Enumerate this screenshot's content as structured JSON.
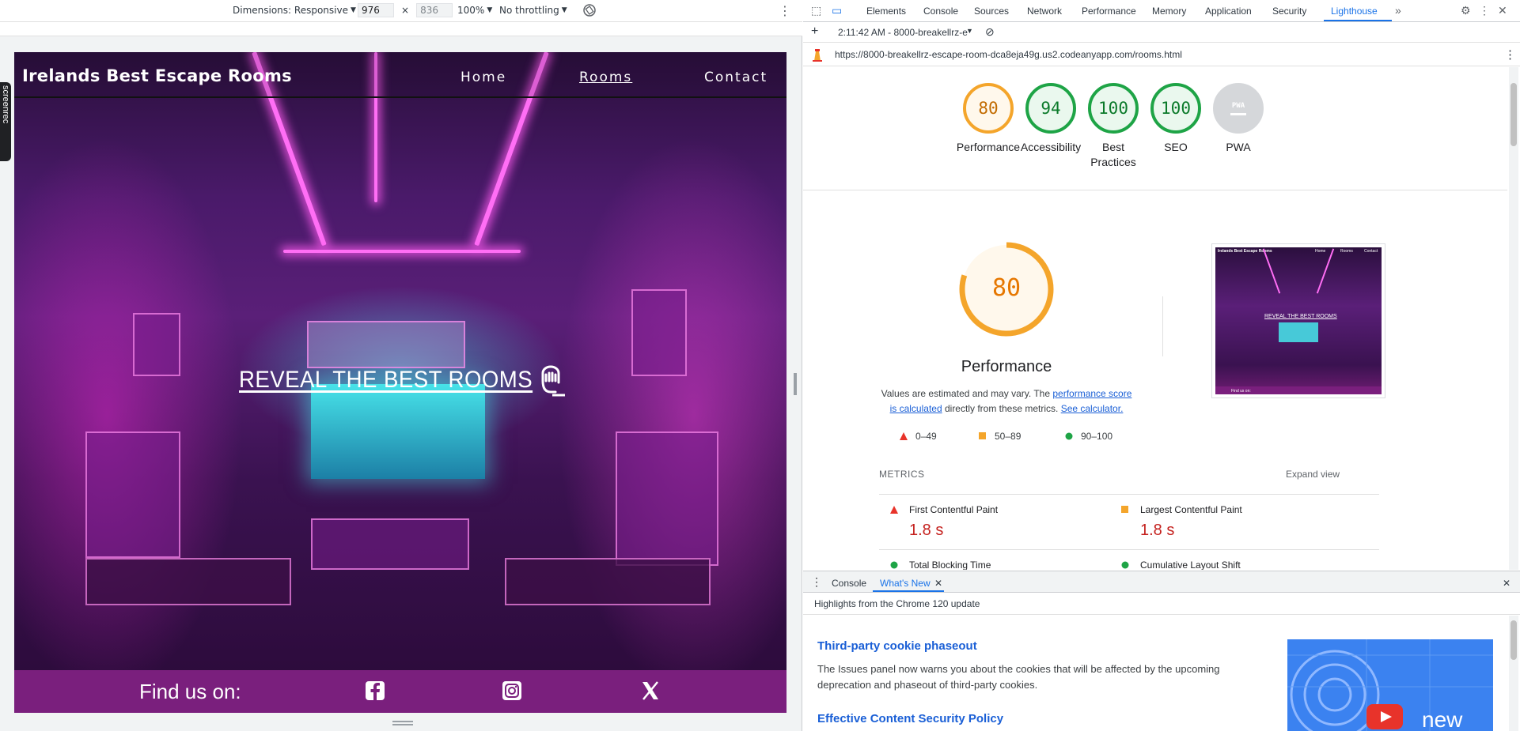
{
  "device_toolbar": {
    "dimensions_label": "Dimensions: Responsive",
    "width": "976",
    "times": "×",
    "height": "836",
    "zoom": "100%",
    "throttling": "No throttling"
  },
  "site": {
    "brand": "Irelands Best Escape Rooms",
    "nav": [
      "Home",
      "Rooms",
      "Contact"
    ],
    "active_nav": "Rooms",
    "hero_link": "REVEAL THE BEST ROOMS",
    "footer_label": "Find us on:",
    "social_icons": [
      "facebook-icon",
      "instagram-icon",
      "x-icon"
    ],
    "colors": {
      "footer": "#7a1f7d",
      "neon": "#ff6ef5"
    }
  },
  "screenrec": {
    "label": "screenrec"
  },
  "devtools": {
    "tabs": [
      "Elements",
      "Console",
      "Sources",
      "Network",
      "Performance",
      "Memory",
      "Application",
      "Security",
      "Lighthouse"
    ],
    "active_tab": "Lighthouse",
    "lh_report_select": "2:11:42 AM - 8000-breakellrz-e",
    "url": "https://8000-breakellrz-escape-room-dca8eja49g.us2.codeanyapp.com/rooms.html",
    "scores": [
      {
        "label": "Performance",
        "value": "80",
        "status": "average"
      },
      {
        "label": "Accessibility",
        "value": "94",
        "status": "pass"
      },
      {
        "label": "Best Practices",
        "value": "100",
        "status": "pass"
      },
      {
        "label": "SEO",
        "value": "100",
        "status": "pass"
      },
      {
        "label": "PWA",
        "value": "",
        "status": "na"
      }
    ],
    "pwa_badge": "PWA",
    "performance": {
      "score": "80",
      "score_fraction": 0.8,
      "title": "Performance",
      "desc_1": "Values are estimated and may vary. The ",
      "desc_link1": "performance score is calculated",
      "desc_2": " directly from these metrics. ",
      "desc_link2": "See calculator.",
      "legend": [
        "0–49",
        "50–89",
        "90–100"
      ]
    },
    "thumbnail": {
      "brand": "Irelands Best Escape Rooms",
      "nav": [
        "Home",
        "Rooms",
        "Contact"
      ],
      "hero": "REVEAL THE BEST ROOMS",
      "footer": "Find us on:"
    },
    "metrics_heading": "METRICS",
    "expand_view": "Expand view",
    "metrics": [
      {
        "name": "First Contentful Paint",
        "value": "1.8 s",
        "status": "fail"
      },
      {
        "name": "Largest Contentful Paint",
        "value": "1.8 s",
        "status": "average"
      },
      {
        "name": "Total Blocking Time",
        "value": "",
        "status": "pass"
      },
      {
        "name": "Cumulative Layout Shift",
        "value": "",
        "status": "pass"
      }
    ],
    "colors": {
      "fail": "#e8332a",
      "average": "#f4a52b",
      "pass": "#1ea446",
      "link": "#1a5fd6"
    }
  },
  "drawer": {
    "tabs": [
      "Console",
      "What's New"
    ],
    "active_tab": "What's New",
    "subtitle": "Highlights from the Chrome 120 update",
    "items": [
      {
        "title": "Third-party cookie phaseout",
        "body": "The Issues panel now warns you about the cookies that will be affected by the upcoming deprecation and phaseout of third-party cookies."
      },
      {
        "title": "Effective Content Security Policy",
        "body": ""
      }
    ],
    "video_badge": "new"
  }
}
